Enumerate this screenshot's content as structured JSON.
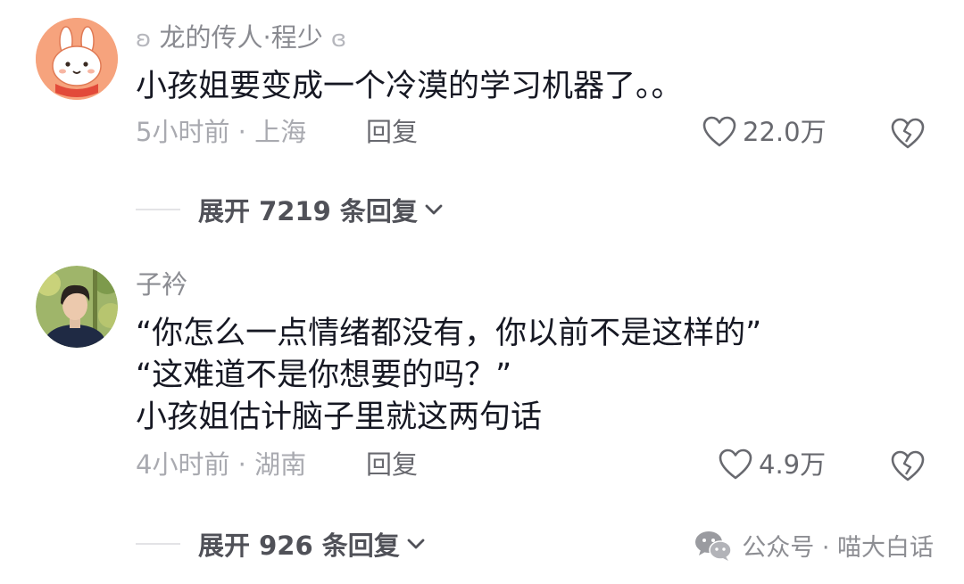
{
  "comments": [
    {
      "avatar_icon": "bunny-avatar-icon",
      "username": "龙的传人·程少",
      "text": "小孩姐要变成一个冷漠的学习机器了。。",
      "time_location": "5小时前 · 上海",
      "reply_label": "回复",
      "like_count": "22.0万",
      "expand_label": "展开 7219 条回复"
    },
    {
      "avatar_icon": "person-photo-avatar-icon",
      "username": "子衿",
      "text": "“你怎么一点情绪都没有，你以前不是这样的”\n“这难道不是你想要的吗？”\n小孩姐估计脑子里就这两句话",
      "time_location": "4小时前 · 湖南",
      "reply_label": "回复",
      "like_count": "4.9万",
      "expand_label": "展开 926 条回复"
    }
  ],
  "watermark": {
    "icon": "wechat-icon",
    "text": "公众号 · 喵大白话"
  },
  "colors": {
    "text_primary": "#161823",
    "text_secondary": "#a9aab0",
    "username": "#8a8b91",
    "action": "#68696f",
    "bunny_avatar_bg": "#f6a37d"
  }
}
